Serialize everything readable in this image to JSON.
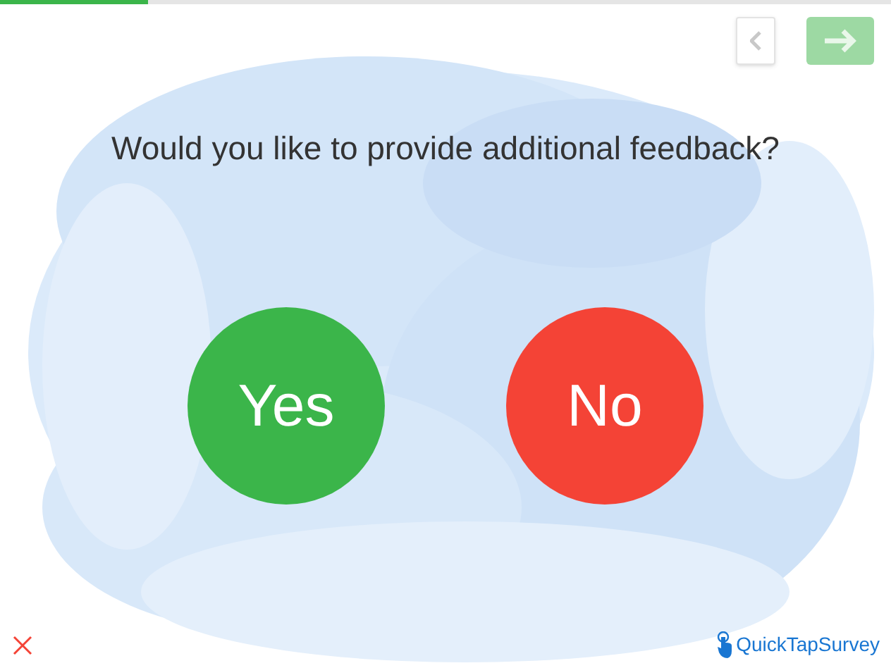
{
  "progress": {
    "level": 0.166
  },
  "navigation": {
    "back_disabled": false,
    "next_disabled": true
  },
  "question": "Would you like to provide additional feedback?",
  "answers": [
    {
      "label": "Yes",
      "color": "#3bb54a"
    },
    {
      "label": "No",
      "color": "#f44336"
    }
  ],
  "footer": {
    "brand": "QuickTapSurvey"
  }
}
